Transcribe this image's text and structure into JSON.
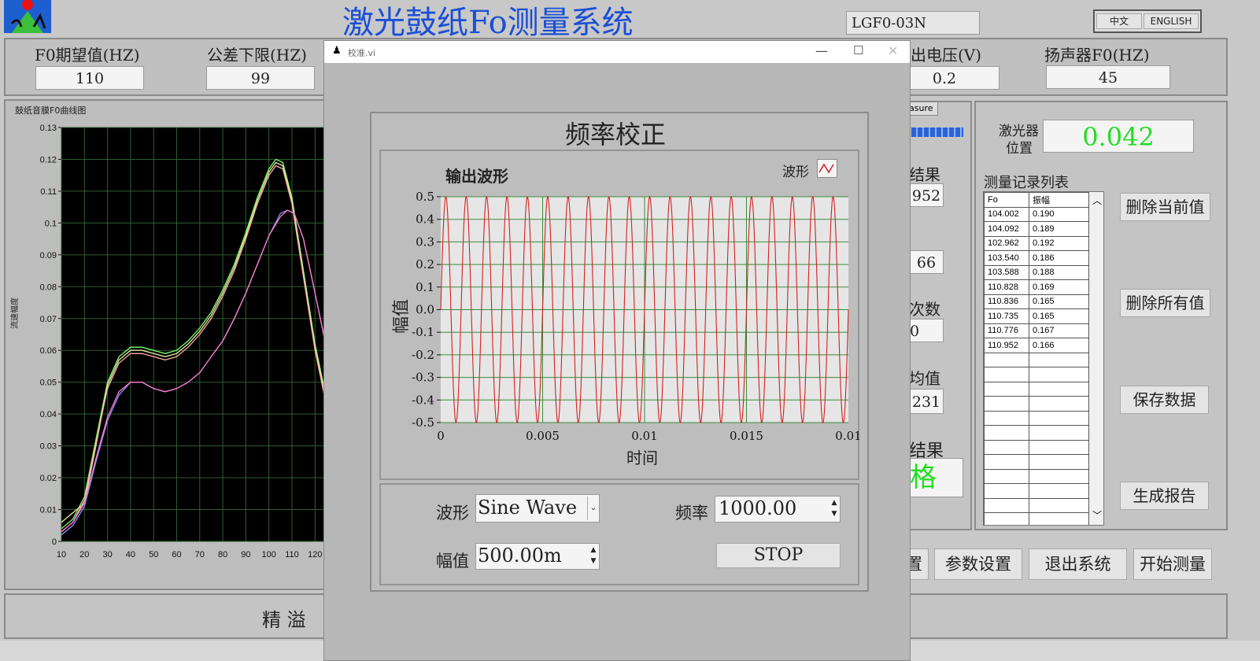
{
  "header": {
    "app_title": "激光鼓纸Fo测量系统",
    "model": "LGF0-03N",
    "lang_cn": "中文",
    "lang_en": "ENGLISH"
  },
  "params": [
    {
      "label": "F0期望值(HZ)",
      "value": "110"
    },
    {
      "label": "公差下限(HZ)",
      "value": "99"
    },
    {
      "label": "出电压(V)",
      "value": "0.2"
    },
    {
      "label": "扬声器F0(HZ)",
      "value": "45"
    }
  ],
  "main_chart": {
    "title": "鼓纸音膜F0曲线图",
    "ylabel": "流速幅度",
    "ytick_labels": [
      "0.13",
      "0.12",
      "0.11",
      "0.1",
      "0.09",
      "0.08",
      "0.07",
      "0.06",
      "0.05",
      "0.04",
      "0.03",
      "0.02",
      "0.01",
      "0"
    ],
    "xtick_labels": [
      "10",
      "20",
      "30",
      "40",
      "50",
      "60",
      "70",
      "80",
      "90",
      "100",
      "110",
      "120"
    ]
  },
  "right_panel": {
    "measure_tab": "asure",
    "laser_label_1": "激光器",
    "laser_label_2": "位置",
    "laser_value": "0.042",
    "result_label": "结果",
    "result_value": "952",
    "field2_value": "66",
    "count_label": "次数",
    "count_value": "0",
    "avg_label": "均值",
    "avg_value": "231",
    "verdict_label": "结果",
    "verdict_value": "格"
  },
  "record_list": {
    "title": "测量记录列表",
    "col_fo": "Fo",
    "col_amp": "振幅",
    "rows": [
      [
        "104.002",
        "0.190"
      ],
      [
        "104.092",
        "0.189"
      ],
      [
        "102.962",
        "0.192"
      ],
      [
        "103.540",
        "0.186"
      ],
      [
        "103.588",
        "0.188"
      ],
      [
        "110.828",
        "0.169"
      ],
      [
        "110.836",
        "0.165"
      ],
      [
        "110.735",
        "0.165"
      ],
      [
        "110.776",
        "0.167"
      ],
      [
        "110.952",
        "0.166"
      ]
    ]
  },
  "side_buttons": {
    "delete_current": "删除当前值",
    "delete_all": "删除所有值",
    "save_data": "保存数据",
    "gen_report": "生成报告"
  },
  "bottom_buttons": {
    "settings_partial": "置",
    "param_settings": "参数设置",
    "exit_system": "退出系统",
    "start_measure": "开始测量"
  },
  "footer": {
    "company": "精 溢"
  },
  "dialog": {
    "title": "校准.vi",
    "heading": "频率校正",
    "chart_title": "输出波形",
    "legend_label": "波形",
    "xlabel": "时间",
    "ylabel": "幅值",
    "ytick_labels": [
      "0.5",
      "0.4",
      "0.3",
      "0.2",
      "0.1",
      "0.0",
      "-0.1",
      "-0.2",
      "-0.3",
      "-0.4",
      "-0.5"
    ],
    "xtick_labels": [
      "0",
      "0.005",
      "0.01",
      "0.015",
      "0.01"
    ],
    "waveform_label": "波形",
    "waveform_value": "Sine Wave",
    "frequency_label": "频率",
    "frequency_value": "1000.00",
    "amplitude_label": "幅值",
    "amplitude_value": "500.00m",
    "stop_label": "STOP"
  },
  "chart_data": [
    {
      "type": "line",
      "title": "鼓纸音膜F0曲线图",
      "ylabel": "流速幅度",
      "xlim": [
        10,
        124
      ],
      "ylim": [
        0,
        0.13
      ],
      "grid": true,
      "series": [
        {
          "color": "#7cff6a",
          "x": [
            10,
            15,
            20,
            25,
            30,
            35,
            40,
            45,
            50,
            55,
            60,
            65,
            70,
            75,
            80,
            85,
            90,
            95,
            100,
            103,
            106,
            110,
            115,
            120,
            124
          ],
          "y": [
            0.004,
            0.007,
            0.014,
            0.032,
            0.05,
            0.058,
            0.061,
            0.061,
            0.06,
            0.059,
            0.06,
            0.063,
            0.067,
            0.072,
            0.079,
            0.087,
            0.097,
            0.108,
            0.117,
            0.12,
            0.119,
            0.108,
            0.085,
            0.062,
            0.048
          ]
        },
        {
          "color": "#e8e8a0",
          "x": [
            10,
            15,
            20,
            25,
            30,
            35,
            40,
            45,
            50,
            55,
            60,
            65,
            70,
            75,
            80,
            85,
            90,
            95,
            100,
            103,
            106,
            110,
            115,
            120,
            124
          ],
          "y": [
            0.006,
            0.009,
            0.012,
            0.03,
            0.049,
            0.057,
            0.06,
            0.06,
            0.059,
            0.058,
            0.059,
            0.062,
            0.066,
            0.071,
            0.078,
            0.086,
            0.096,
            0.107,
            0.116,
            0.119,
            0.118,
            0.107,
            0.084,
            0.061,
            0.047
          ]
        },
        {
          "color": "#ffaaaa",
          "x": [
            10,
            15,
            20,
            25,
            30,
            35,
            40,
            45,
            50,
            55,
            60,
            65,
            70,
            75,
            80,
            85,
            90,
            95,
            100,
            103,
            106,
            110,
            115,
            120,
            124
          ],
          "y": [
            0.003,
            0.006,
            0.013,
            0.031,
            0.048,
            0.056,
            0.059,
            0.059,
            0.058,
            0.057,
            0.058,
            0.061,
            0.065,
            0.07,
            0.077,
            0.085,
            0.095,
            0.106,
            0.115,
            0.118,
            0.117,
            0.106,
            0.083,
            0.06,
            0.046
          ]
        },
        {
          "color": "#8e8eff",
          "x": [
            10,
            15,
            20,
            25,
            30,
            35,
            40,
            45,
            50,
            55,
            60,
            65,
            70,
            75,
            80,
            85,
            90,
            95,
            100,
            105,
            108,
            111,
            115,
            120,
            124
          ],
          "y": [
            0.002,
            0.005,
            0.011,
            0.025,
            0.038,
            0.046,
            0.05,
            0.05,
            0.048,
            0.047,
            0.048,
            0.05,
            0.053,
            0.058,
            0.063,
            0.07,
            0.078,
            0.087,
            0.096,
            0.103,
            0.104,
            0.103,
            0.095,
            0.078,
            0.064
          ]
        },
        {
          "color": "#ff7ad0",
          "x": [
            10,
            15,
            20,
            25,
            30,
            35,
            40,
            45,
            50,
            55,
            60,
            65,
            70,
            75,
            80,
            85,
            90,
            95,
            100,
            105,
            108,
            111,
            115,
            120,
            124
          ],
          "y": [
            0.003,
            0.006,
            0.012,
            0.026,
            0.039,
            0.047,
            0.05,
            0.05,
            0.048,
            0.047,
            0.048,
            0.05,
            0.053,
            0.058,
            0.063,
            0.07,
            0.078,
            0.087,
            0.096,
            0.102,
            0.104,
            0.103,
            0.095,
            0.078,
            0.064
          ]
        }
      ]
    },
    {
      "type": "line",
      "title": "输出波形",
      "xlabel": "时间",
      "ylabel": "幅值",
      "xlim": [
        0,
        0.02
      ],
      "ylim": [
        -0.5,
        0.5
      ],
      "grid": true,
      "series": [
        {
          "name": "波形",
          "color": "#d42020",
          "waveform": "sine",
          "frequency": 1000,
          "amplitude": 0.5
        }
      ]
    }
  ]
}
